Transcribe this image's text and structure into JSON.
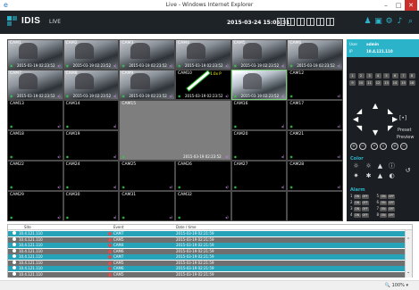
{
  "window": {
    "title": "Live - Windows Internet Explorer",
    "min": "–",
    "max": "□",
    "close": "✕"
  },
  "app": {
    "logo": "IDIS",
    "mode": "LIVE",
    "datetime": "2015-03-24 15:05:31"
  },
  "header_icons": [
    "layout-1x1-icon",
    "layout-2x2-icon",
    "layout-3x3-icon",
    "layout-4x4-icon",
    "layout-custom-icon",
    "layout-fullscreen-icon"
  ],
  "toolbar_icons": [
    "user-icon",
    "monitor-icon",
    "settings-icon",
    "bell-icon",
    "search-icon"
  ],
  "cameras": [
    {
      "name": "CAM1",
      "has_video": true,
      "time": "2015-03-19 02:23:52"
    },
    {
      "name": "CAM2",
      "has_video": true,
      "time": "2015-03-19 02:23:52"
    },
    {
      "name": "CAM3",
      "has_video": true,
      "time": "2015-03-19 02:23:52"
    },
    {
      "name": "CAM4",
      "has_video": true,
      "time": "2015-03-19 02:23:52"
    },
    {
      "name": "CAM5",
      "has_video": true,
      "time": "2015-03-19 02:23:52"
    },
    {
      "name": "CAM6",
      "has_video": true,
      "time": "2015-03-19 02:23:52"
    },
    {
      "name": "CAM7",
      "has_video": true,
      "time": "2015-03-19 02:23:52"
    },
    {
      "name": "CAM8",
      "has_video": true,
      "time": "2015-03-19 02:23:52"
    },
    {
      "name": "CAM9",
      "has_video": true,
      "time": "2015-03-19 02:23:52"
    },
    {
      "name": "CAM10",
      "has_video": false,
      "time": "2015-03-19 02:23:52",
      "fps": "1.0x P"
    },
    {
      "name": "CAM11",
      "has_video": false,
      "time": "2015-03-19 02:23:52"
    },
    {
      "name": "CAM12",
      "has_video": false,
      "time": ""
    },
    {
      "name": "CAM13",
      "has_video": false,
      "time": ""
    },
    {
      "name": "CAM14",
      "has_video": false,
      "time": ""
    },
    {
      "name": "CAM15",
      "has_video": false,
      "time": "2015-03-19 02:23:52"
    },
    {
      "name": "CAM16",
      "has_video": false,
      "time": ""
    },
    {
      "name": "CAM17",
      "has_video": false,
      "time": ""
    },
    {
      "name": "CAM18",
      "has_video": false,
      "time": ""
    },
    {
      "name": "CAM19",
      "has_video": false,
      "time": ""
    },
    {
      "name": "CAM20",
      "has_video": false,
      "time": ""
    },
    {
      "name": "CAM21",
      "has_video": false,
      "time": ""
    },
    {
      "name": "CAM22",
      "has_video": false,
      "time": ""
    },
    {
      "name": "CAM24",
      "has_video": false,
      "time": ""
    },
    {
      "name": "CAM25",
      "has_video": false,
      "time": ""
    },
    {
      "name": "CAM26",
      "has_video": false,
      "time": ""
    },
    {
      "name": "CAM27",
      "has_video": false,
      "time": ""
    },
    {
      "name": "CAM28",
      "has_video": false,
      "time": ""
    },
    {
      "name": "CAM29",
      "has_video": false,
      "time": ""
    },
    {
      "name": "CAM30",
      "has_video": false,
      "time": ""
    },
    {
      "name": "CAM31",
      "has_video": false,
      "time": ""
    },
    {
      "name": "CAM32",
      "has_video": false,
      "time": ""
    }
  ],
  "site": {
    "user_label": "User",
    "user_value": "admin",
    "ip_label": "IP",
    "ip_value": "10.4.121.110"
  },
  "cam_buttons": [
    "1",
    "2",
    "3",
    "4",
    "5",
    "6",
    "7",
    "8",
    "9",
    "10",
    "11",
    "12",
    "13",
    "14",
    "15",
    "16"
  ],
  "ptz": {
    "preset": "Preset",
    "preview": "Preview"
  },
  "color_title": "Color",
  "alarm_title": "Alarm",
  "alarm_rows": [
    {
      "n": "1",
      "n2": "5",
      "on": "ON",
      "off": "OFF"
    },
    {
      "n": "2",
      "n2": "6",
      "on": "ON",
      "off": "OFF"
    },
    {
      "n": "3",
      "n2": "7",
      "on": "ON",
      "off": "OFF"
    },
    {
      "n": "4",
      "n2": "8",
      "on": "ON",
      "off": "OFF"
    }
  ],
  "events": {
    "headers": {
      "site": "Site",
      "event": "Event",
      "time": "Date / time"
    },
    "rows": [
      {
        "site": "10.4.121.110",
        "event": "CAM7",
        "time": "2015-03-19 02:21:59"
      },
      {
        "site": "10.4.121.110",
        "event": "CAM5",
        "time": "2015-03-19 02:21:59"
      },
      {
        "site": "10.4.121.110",
        "event": "CAM4",
        "time": "2015-03-19 02:21:59"
      },
      {
        "site": "10.4.121.110",
        "event": "CAM6",
        "time": "2015-03-19 02:21:59"
      },
      {
        "site": "10.4.121.110",
        "event": "CAM7",
        "time": "2015-03-19 02:21:59"
      },
      {
        "site": "10.4.121.110",
        "event": "CAM5",
        "time": "2015-03-19 02:21:59"
      },
      {
        "site": "10.4.121.110",
        "event": "CAM6",
        "time": "2015-03-19 02:21:59"
      },
      {
        "site": "10.4.121.110",
        "event": "CAM5",
        "time": "2015-03-19 02:21:59"
      }
    ]
  },
  "statusbar": {
    "zoom": "100%"
  },
  "colors": {
    "accent": "#2bb3c9",
    "header_bg": "#1e2328",
    "row_a": "#26a3b8",
    "row_b": "#6f6f6f"
  }
}
